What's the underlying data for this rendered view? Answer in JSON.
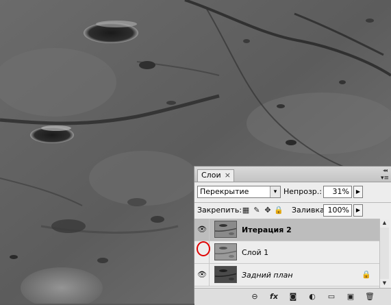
{
  "panel": {
    "tab_title": "Слои",
    "tab_close": "×",
    "collapse_glyph": "◂◂",
    "menu_glyph": "▾≡",
    "blend_mode": "Перекрытие",
    "opacity_label": "Непрозр.:",
    "opacity_value": "31%",
    "lock_label": "Закрепить:",
    "fill_label": "Заливка:",
    "fill_value": "100%",
    "arrow_glyph": "▶",
    "dropdown_glyph": "▾"
  },
  "layers": [
    {
      "name": "Итерация 2",
      "visible": true,
      "selected": true,
      "style": "bold",
      "locked": false
    },
    {
      "name": "Слой 1",
      "visible": false,
      "selected": false,
      "style": "normal",
      "locked": false
    },
    {
      "name": "Задний план",
      "visible": true,
      "selected": false,
      "style": "italic",
      "locked": true
    }
  ],
  "icons": {
    "eye": "👁",
    "lock_pixels": "▦",
    "lock_brush": "✎",
    "lock_move": "✥",
    "lock_all": "🔒",
    "layer_lock": "🔒",
    "link": "⊖",
    "fx": "fx",
    "mask": "◙",
    "adjustment": "◐",
    "group": "▭",
    "new_layer": "▣",
    "delete": "🗑"
  },
  "annotation_color": "#e00000"
}
